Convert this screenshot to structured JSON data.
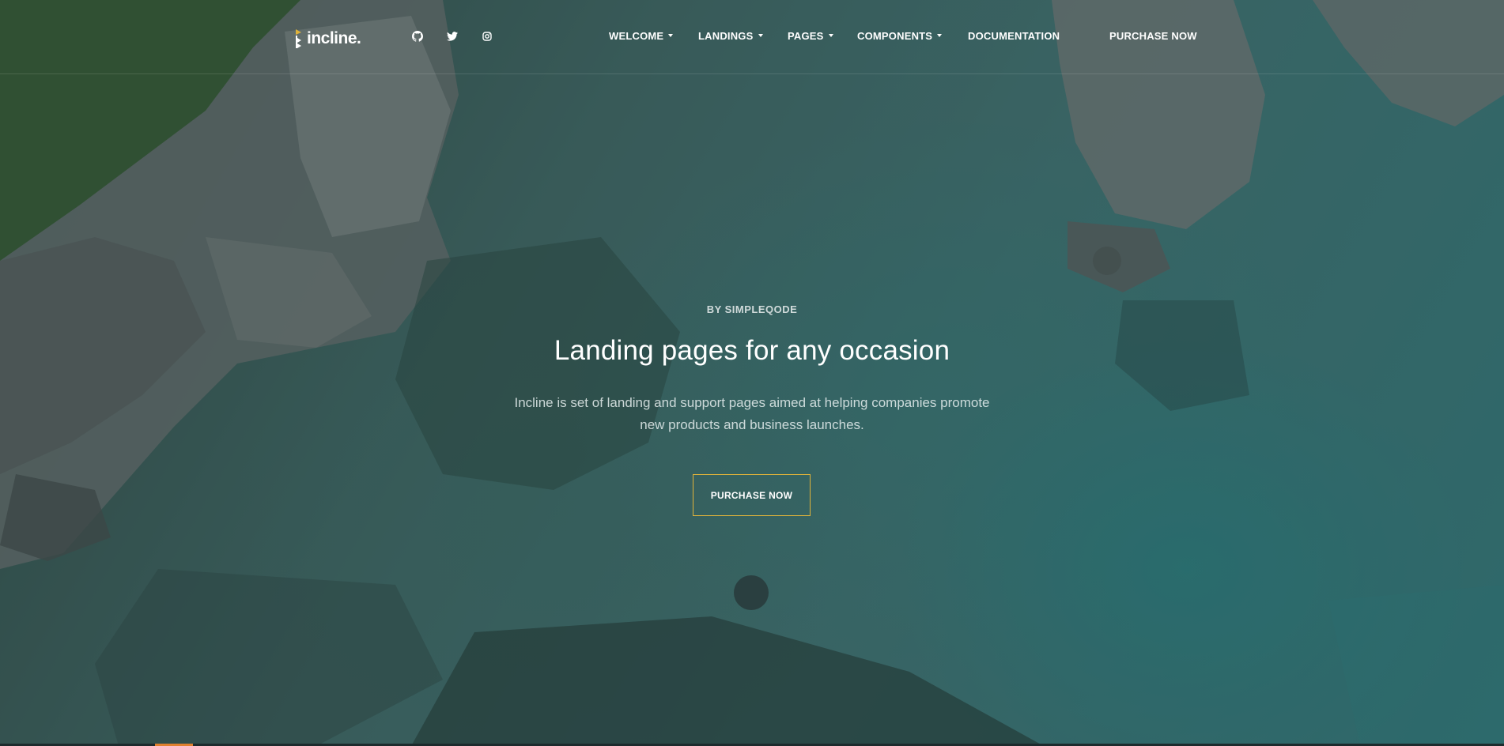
{
  "brand": {
    "name": "incline."
  },
  "social": [
    "github-icon",
    "twitter-icon",
    "instagram-icon"
  ],
  "nav": [
    {
      "label": "WELCOME",
      "dropdown": true
    },
    {
      "label": "LANDINGS",
      "dropdown": true
    },
    {
      "label": "PAGES",
      "dropdown": true
    },
    {
      "label": "COMPONENTS",
      "dropdown": true
    },
    {
      "label": "DOCUMENTATION",
      "dropdown": false
    },
    {
      "label": "PURCHASE NOW",
      "dropdown": false
    }
  ],
  "hero": {
    "eyebrow": "BY SIMPLEQODE",
    "headline": "Landing pages for any occasion",
    "lead_line1": "Incline is set of landing and support pages aimed at helping companies promote",
    "lead_line2": "new products and business launches.",
    "cta": "PURCHASE NOW"
  },
  "colors": {
    "accent": "#e0b33a",
    "overlay": "#14232880",
    "water": "#4f8c89"
  }
}
